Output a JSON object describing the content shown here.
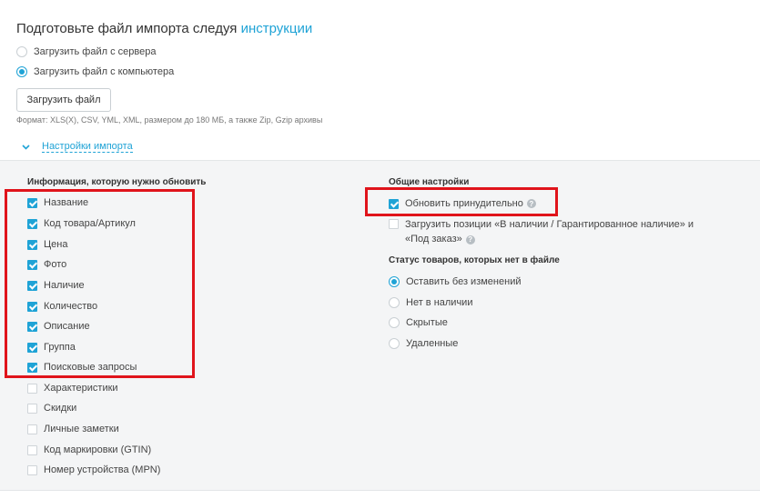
{
  "header": {
    "title_prefix": "Подготовьте файл импорта следуя",
    "title_link": "инструкции"
  },
  "source": {
    "options": [
      {
        "label": "Загрузить файл с сервера",
        "selected": false
      },
      {
        "label": "Загрузить файл с компьютера",
        "selected": true
      }
    ],
    "upload_button": "Загрузить файл",
    "format_hint": "Формат: XLS(X), CSV, YML, XML, размером до 180 МБ, а также Zip, Gzip архивы"
  },
  "settings_toggle": {
    "label": "Настройки импорта",
    "icon": "chevron-down-icon"
  },
  "update_info": {
    "title": "Информация, которую нужно обновить",
    "items": [
      {
        "label": "Название",
        "checked": true
      },
      {
        "label": "Код товара/Артикул",
        "checked": true
      },
      {
        "label": "Цена",
        "checked": true
      },
      {
        "label": "Фото",
        "checked": true
      },
      {
        "label": "Наличие",
        "checked": true
      },
      {
        "label": "Количество",
        "checked": true
      },
      {
        "label": "Описание",
        "checked": true
      },
      {
        "label": "Группа",
        "checked": true
      },
      {
        "label": "Поисковые запросы",
        "checked": true
      },
      {
        "label": "Характеристики",
        "checked": false
      },
      {
        "label": "Скидки",
        "checked": false
      },
      {
        "label": "Личные заметки",
        "checked": false
      },
      {
        "label": "Код маркировки (GTIN)",
        "checked": false
      },
      {
        "label": "Номер устройства (MPN)",
        "checked": false
      }
    ]
  },
  "general": {
    "title": "Общие настройки",
    "force_update": {
      "label": "Обновить принудительно",
      "checked": true,
      "help": "?"
    },
    "load_positions": {
      "label": "Загрузить позиции «В наличии / Гарантированное наличие» и «Под заказ»",
      "checked": false,
      "help": "?"
    }
  },
  "missing_status": {
    "title": "Статус товаров, которых нет в файле",
    "options": [
      {
        "label": "Оставить без изменений",
        "selected": true
      },
      {
        "label": "Нет в наличии",
        "selected": false
      },
      {
        "label": "Скрытые",
        "selected": false
      },
      {
        "label": "Удаленные",
        "selected": false
      }
    ]
  },
  "colors": {
    "accent": "#1fa3d6",
    "highlight_box": "#e0141b",
    "panel_bg": "#f4f5f6"
  }
}
